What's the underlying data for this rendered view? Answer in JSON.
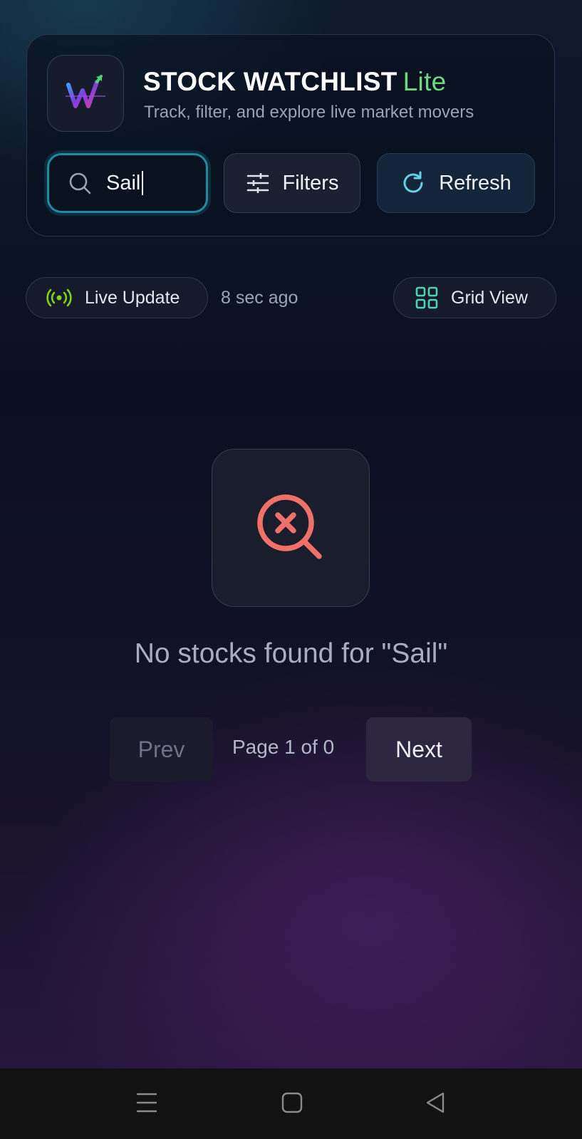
{
  "header": {
    "title": "STOCK WATCHLIST",
    "title_badge": "Lite",
    "subtitle": "Track, filter, and explore live market movers",
    "logo_icon": "w-trend-logo-icon"
  },
  "search": {
    "value": "Sail",
    "icon": "search-icon"
  },
  "toolbar": {
    "filters_label": "Filters",
    "refresh_label": "Refresh"
  },
  "status": {
    "live_label": "Live Update",
    "updated_text": "8 sec ago",
    "view_label": "Grid View"
  },
  "empty_state": {
    "icon": "search-x-icon",
    "message": "No stocks found for \"Sail\""
  },
  "pagination": {
    "prev_label": "Prev",
    "page_text": "Page 1 of 0",
    "next_label": "Next"
  },
  "colors": {
    "accent_green": "#6cd97c",
    "search_border": "#1f8aa3",
    "refresh_icon": "#5fd3e8",
    "grid_icon": "#4fd1b5",
    "live_icon": "#7ed321",
    "empty_icon": "#f07167"
  },
  "system_nav": {
    "icons": [
      "menu-icon",
      "home-square-icon",
      "back-triangle-icon"
    ]
  }
}
